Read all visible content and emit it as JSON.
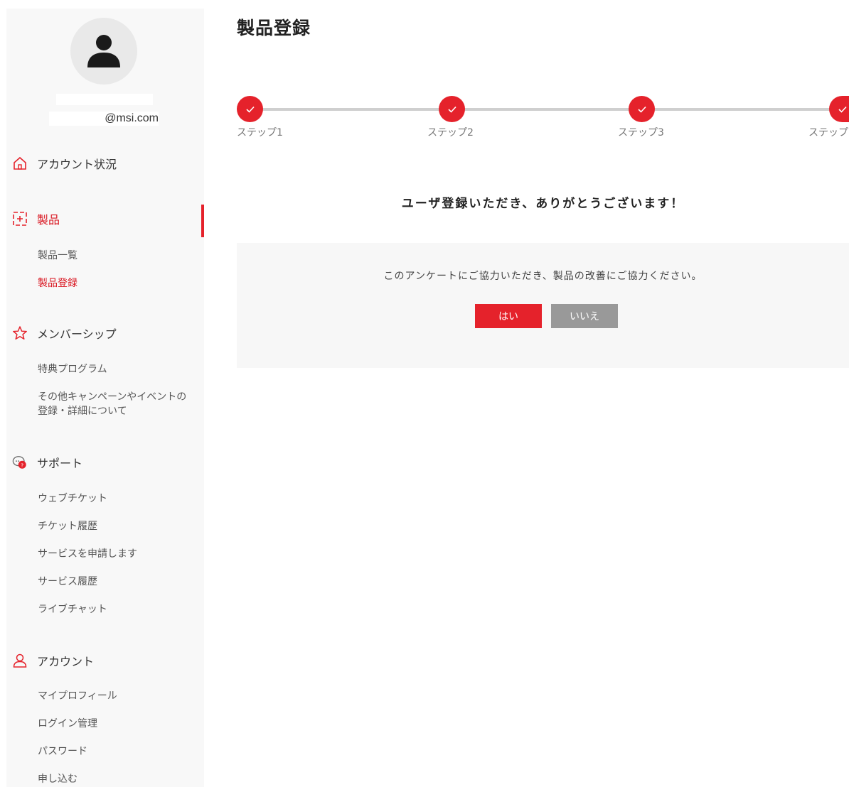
{
  "page": {
    "title": "製品登録"
  },
  "user": {
    "email": "@msi.com"
  },
  "sidebar": {
    "account_status": "アカウント状況",
    "products": {
      "label": "製品",
      "items": [
        "製品一覧",
        "製品登録"
      ]
    },
    "membership": {
      "label": "メンバーシップ",
      "items": [
        "特典プログラム",
        "その他キャンペーンやイベントの",
        "登録・詳細について"
      ]
    },
    "support": {
      "label": "サポート",
      "items": [
        "ウェブチケット",
        "チケット履歴",
        "サービスを申請します",
        "サービス履歴",
        "ライブチャット"
      ]
    },
    "account": {
      "label": "アカウント",
      "items": [
        "マイプロフィール",
        "ログイン管理",
        "パスワード",
        "申し込む"
      ]
    }
  },
  "stepper": {
    "steps": [
      "ステップ1",
      "ステップ2",
      "ステップ3",
      "ステップ"
    ]
  },
  "main": {
    "thanks": "ユーザ登録いただき、ありがとうございます！",
    "survey_text": "このアンケートにご協力いただき、製品の改善にご協力ください。",
    "yes_label": "はい",
    "no_label": "いいえ"
  },
  "colors": {
    "accent": "#e5222b",
    "secondary_button": "#999999"
  }
}
